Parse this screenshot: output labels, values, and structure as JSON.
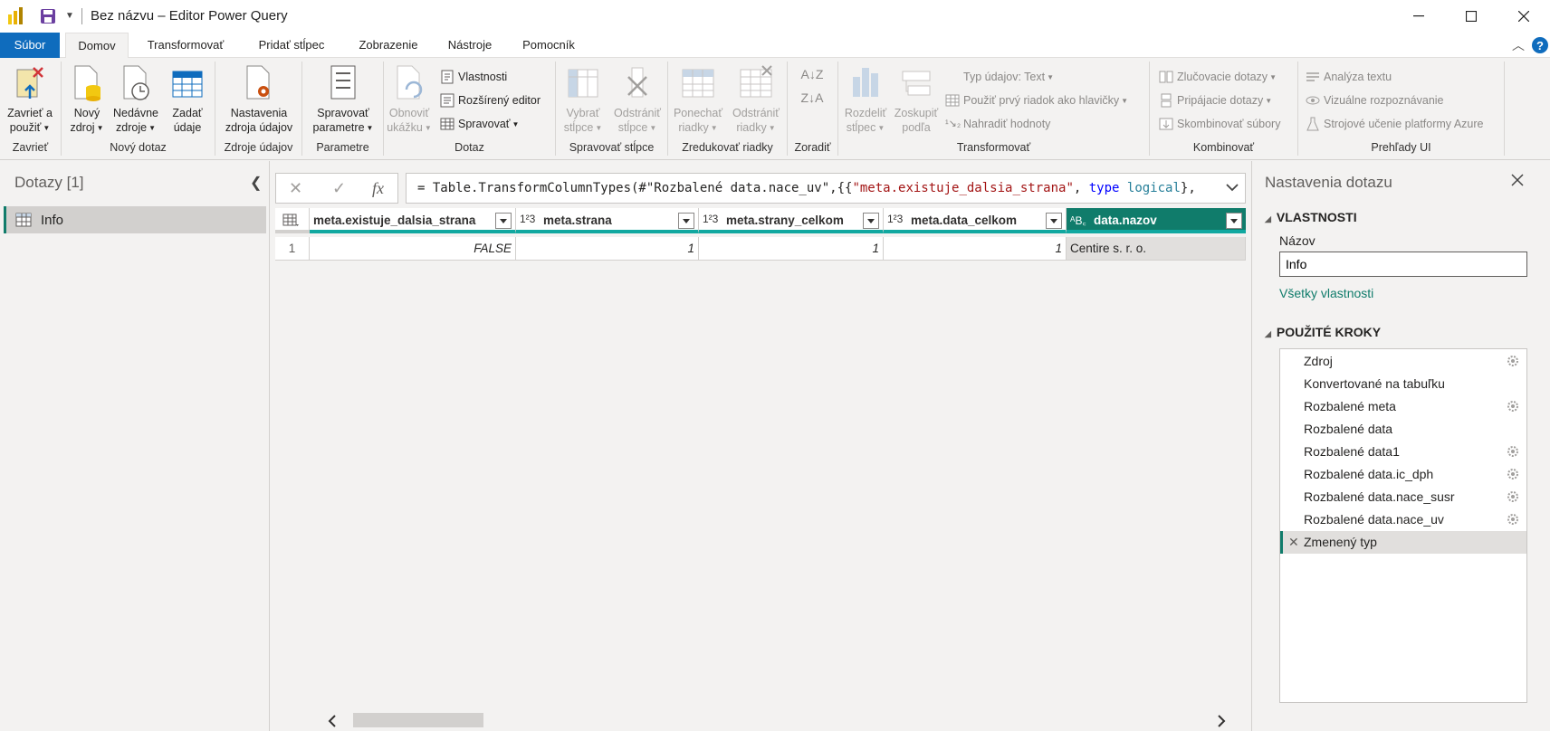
{
  "window": {
    "title": "Bez názvu – Editor Power Query"
  },
  "tabs": [
    "Súbor",
    "Domov",
    "Transformovať",
    "Pridať stĺpec",
    "Zobrazenie",
    "Nástroje",
    "Pomocník"
  ],
  "ribbon": {
    "close_group": {
      "label": "Zavrieť",
      "btn_line1": "Zavrieť a",
      "btn_line2": "použiť"
    },
    "new_query_group": {
      "label": "Nový dotaz",
      "new_source_1": "Nový",
      "new_source_2": "zdroj",
      "recent_1": "Nedávne",
      "recent_2": "zdroje",
      "enter_1": "Zadať",
      "enter_2": "údaje"
    },
    "data_sources_group": {
      "label": "Zdroje údajov",
      "settings_1": "Nastavenia",
      "settings_2": "zdroja údajov"
    },
    "params_group": {
      "label": "Parametre",
      "manage_1": "Spravovať",
      "manage_2": "parametre"
    },
    "query_group": {
      "label": "Dotaz",
      "refresh_1": "Obnoviť",
      "refresh_2": "ukážku",
      "properties": "Vlastnosti",
      "advanced": "Rozšírený editor",
      "manage": "Spravovať"
    },
    "columns_group": {
      "label": "Spravovať stĺpce",
      "choose_1": "Vybrať",
      "choose_2": "stĺpce",
      "remove_1": "Odstrániť",
      "remove_2": "stĺpce"
    },
    "rows_group": {
      "label": "Zredukovať riadky",
      "keep_1": "Ponechať",
      "keep_2": "riadky",
      "remove_1": "Odstrániť",
      "remove_2": "riadky"
    },
    "sort_group": {
      "label": "Zoradiť"
    },
    "transform_group": {
      "label": "Transformovať",
      "split_1": "Rozdeliť",
      "split_2": "stĺpec",
      "group_1": "Zoskupiť",
      "group_2": "podľa",
      "datatype": "Typ údajov: Text",
      "first_row": "Použiť prvý riadok ako hlavičky",
      "replace": "Nahradiť hodnoty"
    },
    "combine_group": {
      "label": "Kombinovať",
      "merge": "Zlučovacie dotazy",
      "append": "Pripájacie dotazy",
      "combine_files": "Skombinovať súbory"
    },
    "ai_group": {
      "label": "Prehľady UI",
      "text": "Analýza textu",
      "vision": "Vizuálne rozpoznávanie",
      "ml": "Strojové učenie platformy Azure"
    }
  },
  "queries": {
    "header": "Dotazy [1]",
    "items": [
      {
        "label": "Info"
      }
    ]
  },
  "formula": {
    "prefix": "= Table.TransformColumnTypes(#\"Rozbalené data.nace_uv\",{{",
    "str": "\"meta.existuje_dalsia_strana\"",
    "mid": ", ",
    "kw": "type",
    "sp": " ",
    "ty": "logical",
    "suffix": "},"
  },
  "grid": {
    "columns": [
      {
        "name": "meta.existuje_dalsia_strana",
        "type": ""
      },
      {
        "name": "meta.strana",
        "type": "1²3"
      },
      {
        "name": "meta.strany_celkom",
        "type": "1²3"
      },
      {
        "name": "meta.data_celkom",
        "type": "1²3"
      },
      {
        "name": "data.nazov",
        "type": "ᴬB꜀"
      }
    ],
    "row_number": "1",
    "row": [
      "FALSE",
      "1",
      "1",
      "1",
      "Centire s. r. o."
    ]
  },
  "settings": {
    "header": "Nastavenia dotazu",
    "properties_title": "VLASTNOSTI",
    "name_label": "Názov",
    "name_value": "Info",
    "all_properties": "Všetky vlastnosti",
    "steps_title": "POUŽITÉ KROKY",
    "steps": [
      {
        "label": "Zdroj"
      },
      {
        "label": "Konvertované na tabuľku"
      },
      {
        "label": "Rozbalené meta"
      },
      {
        "label": "Rozbalené data"
      },
      {
        "label": "Rozbalené data1"
      },
      {
        "label": "Rozbalené data.ic_dph"
      },
      {
        "label": "Rozbalené data.nace_susr"
      },
      {
        "label": "Rozbalené data.nace_uv"
      },
      {
        "label": "Zmenený typ"
      }
    ]
  },
  "colors": {
    "accent": "#107c6b",
    "file_tab": "#0f6cbd",
    "column_bar": "#11a8a0"
  }
}
